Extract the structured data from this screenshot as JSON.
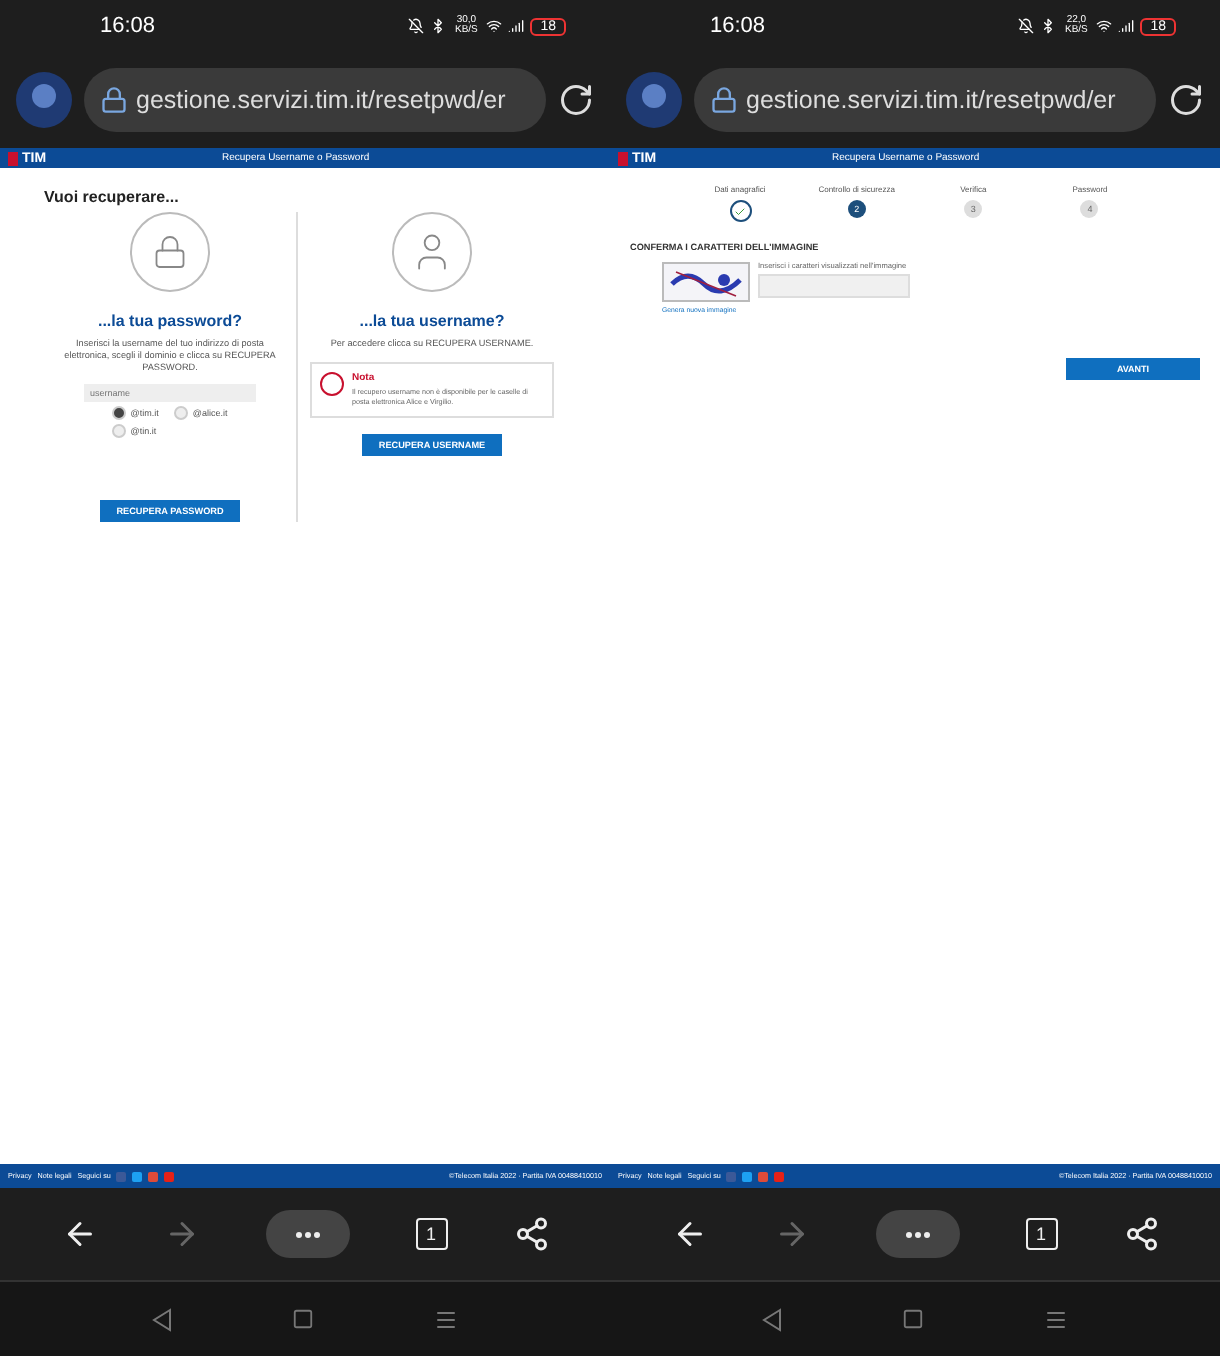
{
  "phones": [
    {
      "status": {
        "time": "16:08",
        "speed": "30,0 KB/S",
        "battery": "18"
      },
      "address_bar": {
        "url": "gestione.servizi.tim.it/resetpwd/er"
      },
      "page": {
        "kind": "choose",
        "brand": "TIM",
        "header_title": "Recupera Username o Password",
        "heading": "Vuoi recuperare...",
        "password_card": {
          "title": "...la tua password?",
          "text": "Inserisci la username del tuo indirizzo di posta elettronica, scegli il dominio e clicca su RECUPERA PASSWORD.",
          "placeholder": "username",
          "domains": [
            {
              "label": "@tim.it",
              "selected": true
            },
            {
              "label": "@alice.it",
              "selected": false
            },
            {
              "label": "@tin.it",
              "selected": false
            }
          ],
          "button": "RECUPERA PASSWORD"
        },
        "username_card": {
          "title": "...la tua username?",
          "text": "Per accedere clicca su RECUPERA USERNAME.",
          "note_title": "Nota",
          "note_text": "Il recupero username non è disponibile per le caselle di posta elettronica Alice e Virgilio.",
          "button": "RECUPERA USERNAME"
        }
      },
      "footer": {
        "links": [
          "Privacy",
          "Note legali",
          "Seguici su"
        ],
        "copyright": "©Telecom Italia 2022 · Partita IVA 00488410010"
      },
      "toolbar": {
        "forward_disabled": true,
        "tabs": "1"
      }
    },
    {
      "status": {
        "time": "16:08",
        "speed": "22,0 KB/S",
        "battery": "18"
      },
      "address_bar": {
        "url": "gestione.servizi.tim.it/resetpwd/er"
      },
      "page": {
        "kind": "captcha",
        "brand": "TIM",
        "header_title": "Recupera Username o Password",
        "steps": [
          {
            "label": "Dati anagrafici",
            "done": true,
            "selected": false
          },
          {
            "label": "Controllo di sicurezza",
            "number": "2",
            "done": false,
            "selected": true
          },
          {
            "label": "Verifica",
            "number": "3",
            "done": false,
            "selected": false
          },
          {
            "label": "Password",
            "number": "4",
            "done": false,
            "selected": false
          }
        ],
        "section_title": "CONFERMA I CARATTERI DELL'IMMAGINE",
        "field_label": "Inserisci i caratteri visualizzati nell'immagine",
        "refresh_link": "Genera nuova immagine",
        "button": "AVANTI"
      },
      "footer": {
        "links": [
          "Privacy",
          "Note legali",
          "Seguici su"
        ],
        "copyright": "©Telecom Italia 2022 · Partita IVA 00488410010"
      },
      "toolbar": {
        "forward_disabled": true,
        "tabs": "1"
      }
    }
  ]
}
